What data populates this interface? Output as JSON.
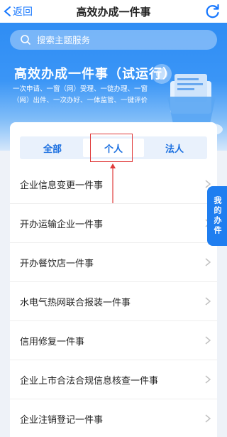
{
  "navbar": {
    "back_label": "返回",
    "title": "高效办成一件事"
  },
  "search": {
    "placeholder": "搜索主题服务"
  },
  "banner": {
    "title": "高效办成一件事（试运行）",
    "desc_line1": "一次申请、一窗（网）受理、一链办理、一窗",
    "desc_line2": "（网）出件、一次办好、一体监管、一键评价"
  },
  "tabs": [
    {
      "label": "全部"
    },
    {
      "label": "个人"
    },
    {
      "label": "法人"
    }
  ],
  "active_tab": "个人",
  "items": [
    {
      "label": "企业信息变更一件事"
    },
    {
      "label": "开办运输企业一件事"
    },
    {
      "label": "开办餐饮店一件事"
    },
    {
      "label": "水电气热网联合报装一件事"
    },
    {
      "label": "信用修复一件事"
    },
    {
      "label": "企业上市合法合规信息核查一件事"
    },
    {
      "label": "企业注销登记一件事"
    }
  ],
  "side_tab": {
    "label": "我的办件"
  },
  "colors": {
    "accent": "#1677ff",
    "banner_top": "#2f8df4",
    "annotation": "#e03b3b"
  }
}
